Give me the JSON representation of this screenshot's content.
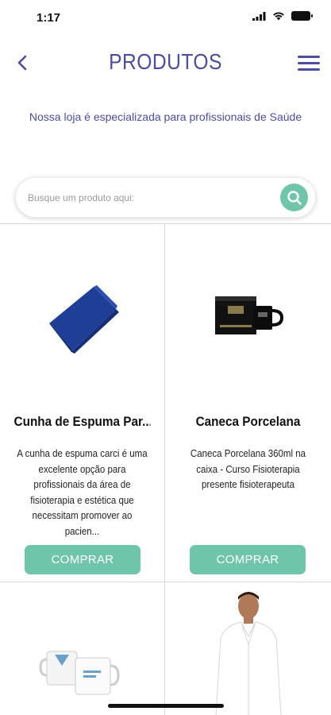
{
  "status_bar": {
    "time": "1:17"
  },
  "header": {
    "title": "PRODUTOS"
  },
  "subtitle": "Nossa loja é especializada para profissionais de Saúde",
  "search": {
    "placeholder": "Busque um produto aqui:"
  },
  "products": [
    {
      "name": "Cunha de Espuma Par...",
      "description": "A cunha de espuma carci é uma excelente opção para profissionais da área de fisioterapia e estética que necessitam promover ao pacien...",
      "button_label": "COMPRAR",
      "image": "blue-foam-wedge"
    },
    {
      "name": "Caneca Porcelana",
      "description": "Caneca Porcelana 360ml na caixa - Curso Fisioterapia presente fisioterapeuta",
      "button_label": "COMPRAR",
      "image": "black-mug-with-box"
    },
    {
      "name": "",
      "description": "",
      "button_label": "",
      "image": "white-mugs"
    },
    {
      "name": "",
      "description": "",
      "button_label": "",
      "image": "white-lab-coat"
    }
  ],
  "colors": {
    "brand": "#4b4da0",
    "accent": "#6ec5ab",
    "grid_line": "#d9d9d9"
  },
  "icons": [
    "back-arrow-icon",
    "menu-icon",
    "search-icon",
    "wifi-icon",
    "signal-icon",
    "battery-icon"
  ]
}
